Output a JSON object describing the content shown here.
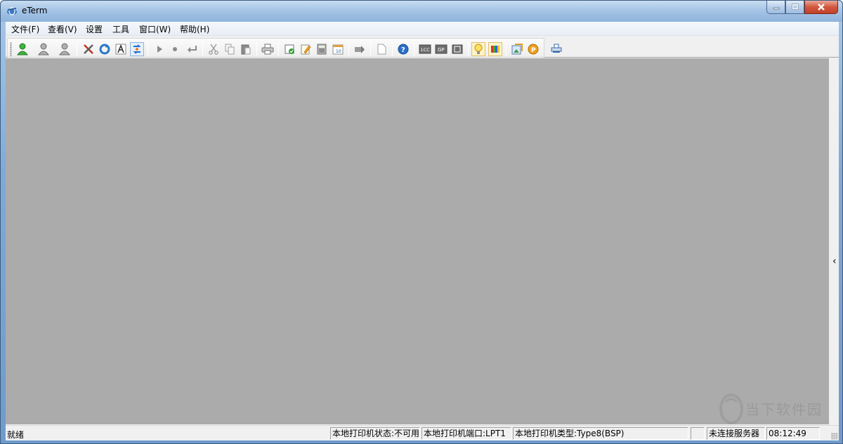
{
  "window": {
    "title": "eTerm"
  },
  "menu": {
    "items": [
      {
        "label": "文件(F)"
      },
      {
        "label": "查看(V)"
      },
      {
        "label": "设置"
      },
      {
        "label": "工具"
      },
      {
        "label": "窗口(W)"
      },
      {
        "label": "帮助(H)"
      }
    ]
  },
  "toolbar": {
    "buttons": [
      {
        "icon": "user-green-icon"
      },
      {
        "icon": "user-gray-icon"
      },
      {
        "icon": "user-gray-icon"
      },
      {
        "icon": "tools-icon"
      },
      {
        "icon": "refresh-icon"
      },
      {
        "icon": "font-icon"
      },
      {
        "icon": "sync-icon"
      },
      {
        "icon": "play-icon"
      },
      {
        "icon": "record-icon"
      },
      {
        "icon": "enter-icon"
      },
      {
        "icon": "cut-icon"
      },
      {
        "icon": "copy-icon"
      },
      {
        "icon": "paste-icon"
      },
      {
        "icon": "print-icon"
      },
      {
        "icon": "flag-icon"
      },
      {
        "icon": "edit-icon"
      },
      {
        "icon": "calculator-icon"
      },
      {
        "icon": "calendar-icon"
      },
      {
        "icon": "forward-icon"
      },
      {
        "icon": "new-page-icon"
      },
      {
        "icon": "help-icon"
      },
      {
        "icon": "numeric-icon"
      },
      {
        "icon": "gp-icon"
      },
      {
        "icon": "grid-icon"
      },
      {
        "icon": "lightbulb-icon"
      },
      {
        "icon": "color-bars-icon"
      },
      {
        "icon": "image-icon"
      },
      {
        "icon": "coin-icon"
      },
      {
        "icon": "printer-small-icon"
      }
    ]
  },
  "status": {
    "ready": "就绪",
    "printer_state": "本地打印机状态:不可用",
    "printer_port": "本地打印机端口:LPT1",
    "printer_type": "本地打印机类型:Type8(BSP)",
    "server": "未连接服务器",
    "time": "08:12:49"
  },
  "watermark": {
    "text": "当下软件园",
    "url": "www.downxia.com"
  },
  "colors": {
    "mdi_background": "#ababab",
    "titlebar": "#a6c5e6",
    "close_button": "#c2402a"
  }
}
